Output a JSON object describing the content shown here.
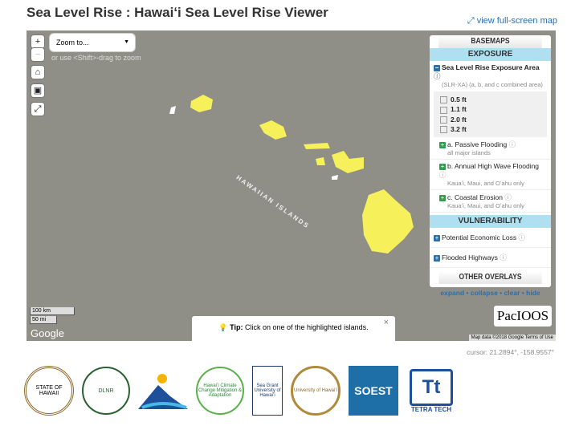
{
  "page": {
    "title": "Sea Level Rise : Hawaiʻi Sea Level Rise Viewer",
    "fullscreen": "view full-screen map",
    "cursor": "cursor: 21.2894°, -158.9557°"
  },
  "map": {
    "zoom_in": "+",
    "zoom_out": "−",
    "zoom_select": "Zoom to...",
    "zoom_hint": "or use <Shift>-drag to zoom",
    "islands_label": "HAWAIIAN ISLANDS",
    "scale_km": "100 km",
    "scale_mi": "50 mi",
    "google": "Google",
    "attribution": "Map data ©2018 Google   Terms of Use",
    "pacioos": "PacIOOS",
    "tip_label": "Tip:",
    "tip_text": "Click on one of the highlighted islands.",
    "tip_close": "×",
    "island_color": "#f6f05a",
    "ocean_color": "#908f87"
  },
  "panel": {
    "basemaps": "BASEMAPS",
    "exposure": "EXPOSURE",
    "slrxa": {
      "label": "Sea Level Rise Exposure Area",
      "sub": "(SLR-XA) (a, b, and c combined area)",
      "options": [
        "0.5 ft",
        "1.1 ft",
        "2.0 ft",
        "3.2 ft"
      ]
    },
    "layers": [
      {
        "label": "a. Passive Flooding",
        "sub": "all major islands"
      },
      {
        "label": "b. Annual High Wave Flooding",
        "sub": "Kauaʻi, Maui, and Oʻahu only"
      },
      {
        "label": "c. Coastal Erosion",
        "sub": "Kauaʻi, Maui, and Oʻahu only"
      }
    ],
    "vulnerability": "VULNERABILITY",
    "vuln_items": [
      "Potential Economic Loss",
      "Flooded Highways"
    ],
    "other": "OTHER OVERLAYS",
    "links": [
      "expand",
      "collapse",
      "clear",
      "hide"
    ],
    "sep": " • "
  },
  "logos": [
    "STATE OF HAWAII",
    "DLNR",
    "",
    "Hawaiʻi Climate Change Mitigation & Adaptation",
    "Sea Grant University of Hawaiʻi",
    "University of Hawaiʻi",
    "SOEST",
    "TETRA TECH"
  ]
}
